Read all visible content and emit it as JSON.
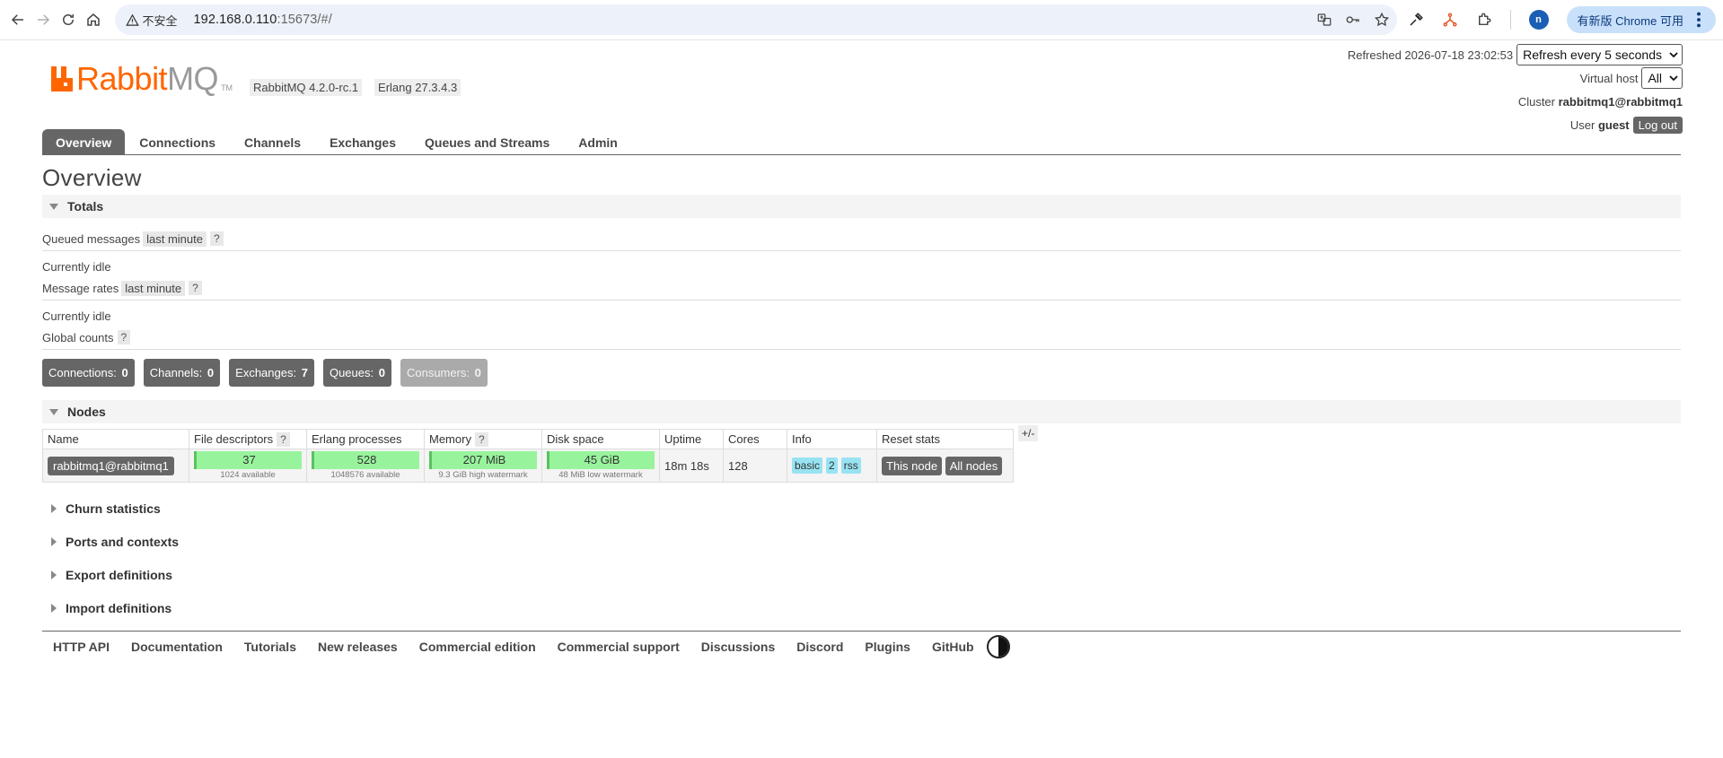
{
  "browser": {
    "security_label": "不安全",
    "url_host": "192.168.0.110",
    "url_rest": ":15673/#/",
    "profile_initial": "n",
    "update_label": "有新版 Chrome 可用"
  },
  "header": {
    "logo_rabbit": "Rabbit",
    "logo_mq": "MQ",
    "logo_tm": "TM",
    "version": "RabbitMQ 4.2.0-rc.1",
    "erlang": "Erlang 27.3.4.3",
    "refreshed_label": "Refreshed 2026-07-18 23:02:53",
    "refresh_select": "Refresh every 5 seconds",
    "vhost_label": "Virtual host",
    "vhost_select": "All",
    "cluster_label": "Cluster",
    "cluster_name": "rabbitmq1@rabbitmq1",
    "user_label": "User",
    "user_name": "guest",
    "logout": "Log out"
  },
  "tabs": [
    "Overview",
    "Connections",
    "Channels",
    "Exchanges",
    "Queues and Streams",
    "Admin"
  ],
  "overview": {
    "title": "Overview",
    "totals_heading": "Totals",
    "queued_label": "Queued messages",
    "queued_range": "last minute",
    "help": "?",
    "idle1": "Currently idle",
    "rates_label": "Message rates",
    "rates_range": "last minute",
    "idle2": "Currently idle",
    "global_label": "Global counts",
    "counts": [
      {
        "label": "Connections:",
        "value": "0"
      },
      {
        "label": "Channels:",
        "value": "0"
      },
      {
        "label": "Exchanges:",
        "value": "7"
      },
      {
        "label": "Queues:",
        "value": "0"
      },
      {
        "label": "Consumers:",
        "value": "0"
      }
    ]
  },
  "nodes": {
    "heading": "Nodes",
    "columns": {
      "name": "Name",
      "fd": "File descriptors",
      "erl": "Erlang processes",
      "mem": "Memory",
      "disk": "Disk space",
      "uptime": "Uptime",
      "cores": "Cores",
      "info": "Info",
      "reset": "Reset stats"
    },
    "plusminus": "+/-",
    "row": {
      "name": "rabbitmq1@rabbitmq1",
      "fd": "37",
      "fd_sub": "1024 available",
      "erl": "528",
      "erl_sub": "1048576 available",
      "mem": "207 MiB",
      "mem_sub": "9.3 GiB high watermark",
      "disk": "45 GiB",
      "disk_sub": "48 MiB low watermark",
      "uptime": "18m 18s",
      "cores": "128",
      "info": [
        "basic",
        "2",
        "rss"
      ],
      "this_node": "This node",
      "all_nodes": "All nodes"
    }
  },
  "sections": [
    "Churn statistics",
    "Ports and contexts",
    "Export definitions",
    "Import definitions"
  ],
  "footer": [
    "HTTP API",
    "Documentation",
    "Tutorials",
    "New releases",
    "Commercial edition",
    "Commercial support",
    "Discussions",
    "Discord",
    "Plugins",
    "GitHub"
  ],
  "colors": {
    "brand_orange": "#ff6600",
    "tab_active": "#666666",
    "bar_green": "#98f49c",
    "info_tag": "#98e3f2"
  }
}
